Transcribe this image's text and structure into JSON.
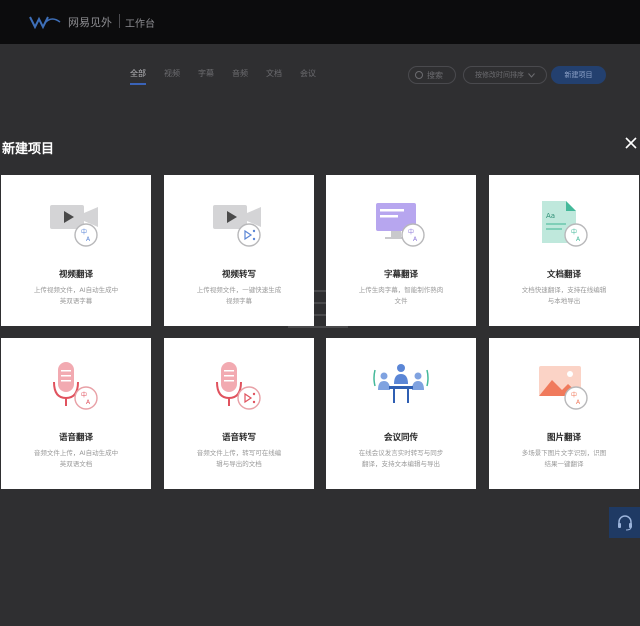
{
  "header": {
    "logo_text": "网易见外",
    "workspace": "工作台"
  },
  "tabs": [
    {
      "label": "全部",
      "active": true
    },
    {
      "label": "视频",
      "active": false
    },
    {
      "label": "字幕",
      "active": false
    },
    {
      "label": "音频",
      "active": false
    },
    {
      "label": "文档",
      "active": false
    },
    {
      "label": "会议",
      "active": false
    }
  ],
  "toolbar": {
    "search_label": "搜索",
    "sort_label": "按修改时间排序",
    "new_project_label": "新建项目"
  },
  "modal": {
    "title": "新建项目",
    "cards": [
      {
        "name": "视频翻译",
        "desc": "上传视频文件，AI自动生成中英双语字幕",
        "icon": "video-translate-icon"
      },
      {
        "name": "视频转写",
        "desc": "上传视频文件，一键快速生成视频字幕",
        "icon": "video-transcribe-icon"
      },
      {
        "name": "字幕翻译",
        "desc": "上传生肉字幕，智能制作熟肉文件",
        "icon": "subtitle-translate-icon"
      },
      {
        "name": "文档翻译",
        "desc": "文档快速翻译，支持在线编辑与本地导出",
        "icon": "document-translate-icon"
      },
      {
        "name": "语音翻译",
        "desc": "音频文件上传，AI自动生成中英双语文档",
        "icon": "audio-translate-icon"
      },
      {
        "name": "语音转写",
        "desc": "音频文件上传，转写可在线编辑与导出的文档",
        "icon": "audio-transcribe-icon"
      },
      {
        "name": "会议同传",
        "desc": "在线会议发言实时转写与同步翻译，支持文本编辑与导出",
        "icon": "meeting-interpret-icon"
      },
      {
        "name": "图片翻译",
        "desc": "多场景下图片文字识别，识图结果一键翻译",
        "icon": "image-translate-icon"
      }
    ]
  },
  "colors": {
    "overlay_bg": "#2f2f31",
    "accent_blue": "#5b86d6",
    "accent_red": "#e0525e",
    "accent_green": "#44b99a",
    "accent_purple": "#8f7bd9",
    "accent_orange": "#f07a5c"
  }
}
